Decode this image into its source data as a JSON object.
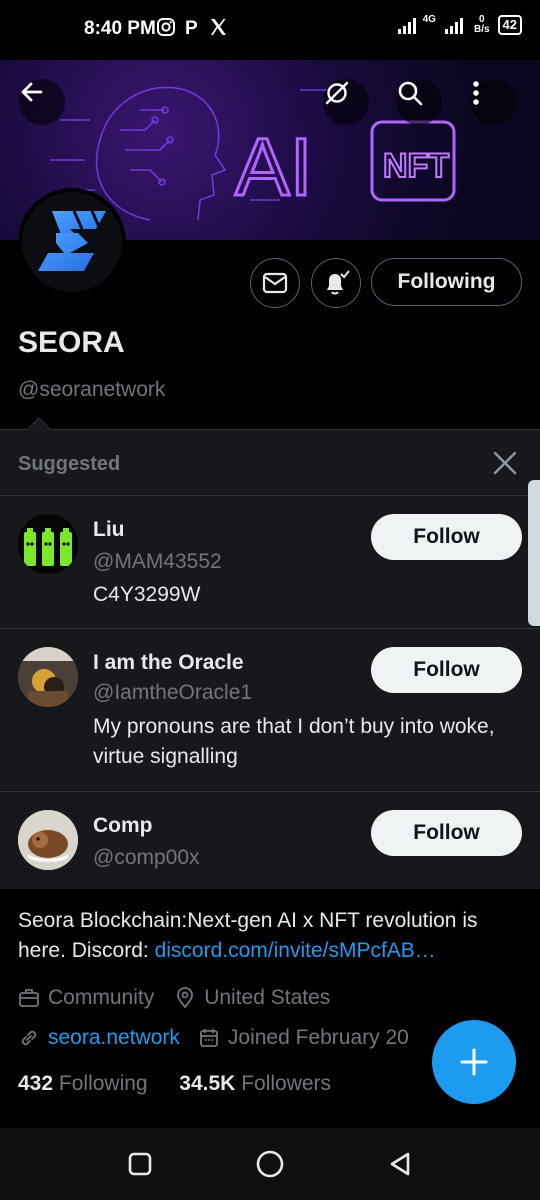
{
  "status_bar": {
    "time": "8:40 PM",
    "network_type": "4G",
    "data_rate_value": "0",
    "data_rate_unit": "B/s",
    "battery": "42"
  },
  "profile": {
    "name": "SEORA",
    "handle": "@seoranetwork",
    "following_button": "Following",
    "banner_text_ai": "AI",
    "banner_text_nft": "NFT"
  },
  "suggested": {
    "title": "Suggested",
    "follow_label": "Follow",
    "accounts": [
      {
        "name": "Liu",
        "handle": "@MAM43552",
        "bio": "C4Y3299W"
      },
      {
        "name": "I am the Oracle",
        "handle": "@IamtheOracle1",
        "bio": "My pronouns are that I don’t buy into woke, virtue signalling"
      },
      {
        "name": "Comp",
        "handle": "@comp00x",
        "bio": ""
      }
    ]
  },
  "bio": {
    "text": "Seora Blockchain:Next-gen AI x NFT revolution is here. Discord: ",
    "link": "discord.com/invite/sMPcfAB…"
  },
  "meta": {
    "category": "Community",
    "location": "United States",
    "website": "seora.network",
    "joined": "Joined February 20"
  },
  "stats": {
    "following_count": "432",
    "following_label": "Following",
    "followers_count": "34.5K",
    "followers_label": "Followers"
  },
  "colors": {
    "accent": "#1d9bf0",
    "background": "#000000",
    "panel": "#16181c",
    "muted": "#71767b"
  }
}
